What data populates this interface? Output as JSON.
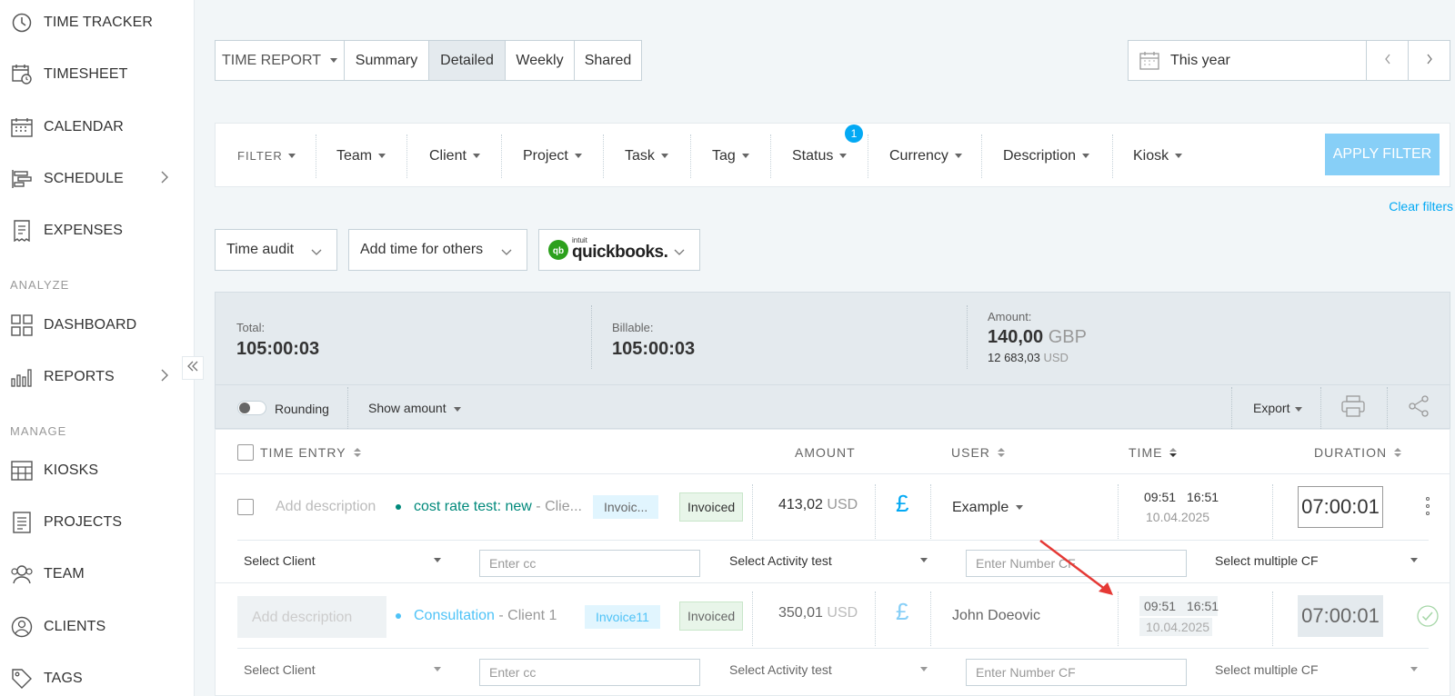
{
  "sidebar": {
    "items": [
      {
        "label": "TIME TRACKER",
        "icon": "clock-icon"
      },
      {
        "label": "TIMESHEET",
        "icon": "timesheet-icon"
      },
      {
        "label": "CALENDAR",
        "icon": "calendar-icon"
      },
      {
        "label": "SCHEDULE",
        "icon": "schedule-icon"
      },
      {
        "label": "EXPENSES",
        "icon": "receipt-icon"
      },
      {
        "label": "DASHBOARD",
        "icon": "dashboard-icon"
      },
      {
        "label": "REPORTS",
        "icon": "bar-chart-icon"
      },
      {
        "label": "KIOSKS",
        "icon": "kiosk-icon"
      },
      {
        "label": "PROJECTS",
        "icon": "document-icon"
      },
      {
        "label": "TEAM",
        "icon": "team-icon"
      },
      {
        "label": "CLIENTS",
        "icon": "client-icon"
      },
      {
        "label": "TAGS",
        "icon": "tag-icon"
      }
    ],
    "sections": {
      "analyze": "ANALYZE",
      "manage": "MANAGE"
    }
  },
  "report_tabs": {
    "type_label": "TIME REPORT",
    "summary": "Summary",
    "detailed": "Detailed",
    "weekly": "Weekly",
    "shared": "Shared"
  },
  "date_range": {
    "label": "This year"
  },
  "filters": {
    "filter": "FILTER",
    "team": "Team",
    "client": "Client",
    "project": "Project",
    "task": "Task",
    "tag": "Tag",
    "status": "Status",
    "status_badge": "1",
    "currency": "Currency",
    "description": "Description",
    "kiosk": "Kiosk",
    "apply": "APPLY FILTER",
    "clear": "Clear filters"
  },
  "actions": {
    "time_audit": "Time audit",
    "add_time": "Add time for others",
    "qb_intuit": "intuit",
    "qb_name": "quickbooks."
  },
  "summary": {
    "total_label": "Total:",
    "total_value": "105:00:03",
    "billable_label": "Billable:",
    "billable_value": "105:00:03",
    "amount_label": "Amount:",
    "amount_value": "140,00",
    "amount_currency": "GBP",
    "amount_sub_value": "12 683,03",
    "amount_sub_currency": "USD",
    "rounding": "Rounding",
    "show_amount": "Show amount",
    "export": "Export"
  },
  "table": {
    "headers": {
      "time_entry": "TIME ENTRY",
      "amount": "AMOUNT",
      "user": "USER",
      "time": "TIME",
      "duration": "DURATION"
    },
    "rows": [
      {
        "description_placeholder": "Add description",
        "project": "cost rate test: new",
        "client": "- Clie...",
        "tag": "Invoic...",
        "status": "Invoiced",
        "amount": "413,02",
        "amount_currency": "USD",
        "currency_symbol": "£",
        "user": "Example",
        "start": "09:51",
        "end": "16:51",
        "date": "10.04.2025",
        "duration": "07:00:01",
        "project_color": "#00897b"
      },
      {
        "description_placeholder": "Add description",
        "project": "Consultation",
        "client": "- Client 1",
        "tag": "Invoice11",
        "status": "Invoiced",
        "amount": "350,01",
        "amount_currency": "USD",
        "currency_symbol": "£",
        "user": "John Doeovic",
        "start": "09:51",
        "end": "16:51",
        "date": "10.04.2025",
        "duration": "07:00:01",
        "project_color": "#4fc3f7"
      }
    ],
    "custom_fields": {
      "select_client": "Select Client",
      "enter_cc": "Enter cc",
      "select_activity": "Select Activity test",
      "enter_number": "Enter Number CF",
      "select_multiple": "Select multiple CF"
    }
  },
  "colors": {
    "accent": "#03a9f4",
    "apply_btn": "#87cff7",
    "annotation_arrow": "#e53935"
  }
}
